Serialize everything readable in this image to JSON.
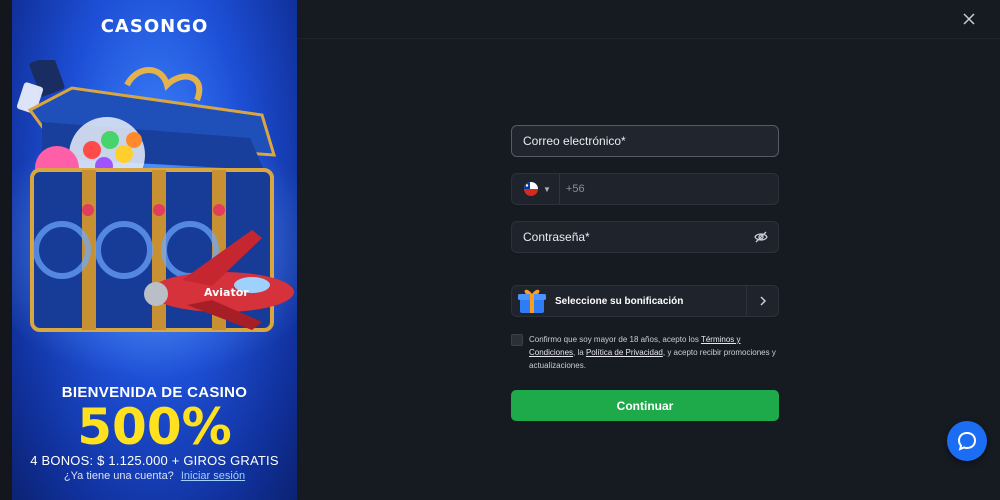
{
  "promo": {
    "brand": "CASONGO",
    "welcome_title": "BIENVENIDA DE CASINO",
    "percent": "500%",
    "bonus_line": "4 BONOS: $ 1.125.000 + GIROS GRATIS",
    "account_question": "¿Ya tiene una cuenta?",
    "login_link": "Iniciar sesión",
    "art_label": "Aviator"
  },
  "form": {
    "email_placeholder": "Correo electrónico*",
    "phone_prefix": "+56",
    "password_placeholder": "Contraseña*",
    "bonus_label": "Seleccione su bonificación",
    "consent_prefix": "Confirmo que soy mayor de 18 años, acepto los ",
    "terms_link": "Términos y Condiciones",
    "consent_mid": ", la ",
    "privacy_link": "Política de Privacidad",
    "consent_suffix": ", y acepto recibir promociones y actualizaciones.",
    "continue_label": "Continuar"
  },
  "icons": {
    "close": "close-icon",
    "eye": "eye-icon",
    "gift": "gift-icon",
    "chevron": "chevron-right-icon",
    "chat": "chat-icon",
    "flag": "chile-flag-icon"
  },
  "colors": {
    "background": "#161a21",
    "accent_green": "#1eaa4a",
    "promo_yellow": "#ffe11f",
    "chat_blue": "#1b6ef3"
  }
}
